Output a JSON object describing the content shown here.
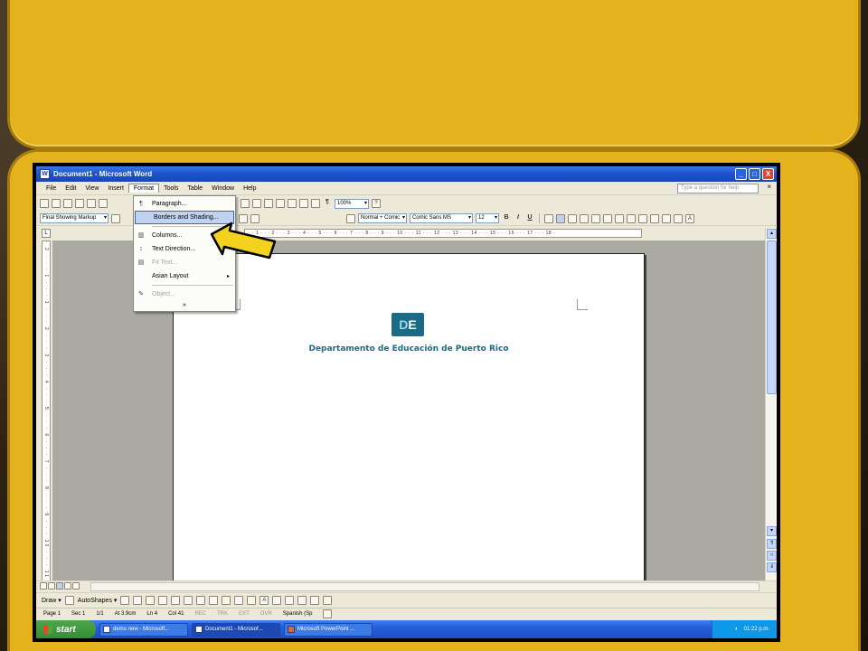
{
  "window": {
    "title": "Document1 - Microsoft Word",
    "title_buttons": [
      "_",
      "□",
      "X"
    ]
  },
  "menubar": {
    "items": [
      "File",
      "Edit",
      "View",
      "Insert",
      "Format",
      "Tools",
      "Table",
      "Window",
      "Help"
    ],
    "help_placeholder": "Type a question for help",
    "close": "×"
  },
  "toolbar1": {
    "zoom": "100%"
  },
  "toolbar2": {
    "markup": "Final Showing Markup",
    "style": "Normal + Comic",
    "font": "Comic Sans MS",
    "size": "12",
    "bold": "B",
    "italic": "I",
    "underline": "U"
  },
  "ruler": {
    "horizontal": "· · 1 · · · 2 · · · 3 · · · 4 · · · 5 · · · 6 · · · 7 · · · 8 · · · 9 · · · 10 · · · 11 · · · 12 · · · 13 · · · 14 · · · 15 · · · 16 · · · 17 · · · 18 ·",
    "vertical": "· 2 · · · 1 · · · 1 · · · 2 · · · 3 · · · 4 · · · 5 · · · 6 · · · 7 · · · 8 · · · 9 · · · 10 · · · 11 · · · 12 ·"
  },
  "format_menu": {
    "items": [
      {
        "label": "Paragraph...",
        "icon": "¶",
        "disabled": false
      },
      {
        "label": "Borders and Shading...",
        "icon": "",
        "highlighted": true
      },
      {
        "label": "Columns...",
        "icon": "▥"
      },
      {
        "label": "Text Direction...",
        "icon": "↕"
      },
      {
        "label": "Fit Text...",
        "icon": "▤",
        "disabled": true
      },
      {
        "label": "Asian Layout",
        "icon": ""
      },
      {
        "label": "Object...",
        "icon": "✎",
        "disabled": true
      }
    ],
    "submenu_arrow": "▸",
    "expand": "»"
  },
  "document": {
    "logo_text_d": "D",
    "logo_text_e": "E",
    "department": "Departamento de Educación de Puerto Rico"
  },
  "drawing_toolbar": {
    "draw": "Draw ▾",
    "autoshapes": "AutoShapes ▾"
  },
  "status": {
    "page": "Page 1",
    "sec": "Sec 1",
    "pages": "1/1",
    "at": "At 3.9cm",
    "ln": "Ln 4",
    "col": "Col 41",
    "rec": "REC",
    "trk": "TRK",
    "ext": "EXT",
    "ovr": "OVR",
    "lang": "Spanish (Sp"
  },
  "taskbar": {
    "start": "start",
    "tasks": [
      {
        "label": "demo new - Microsoft..."
      },
      {
        "label": "Document1 - Microsof..."
      },
      {
        "label": "Microsoft PowerPoint ..."
      }
    ],
    "clock": "01:22 p.m."
  },
  "colors": {
    "slide_yellow": "#e4b21c",
    "titlebar_blue": "#1c54cf",
    "logo_teal": "#1b6a86",
    "arrow_yellow": "#f3d21f"
  }
}
